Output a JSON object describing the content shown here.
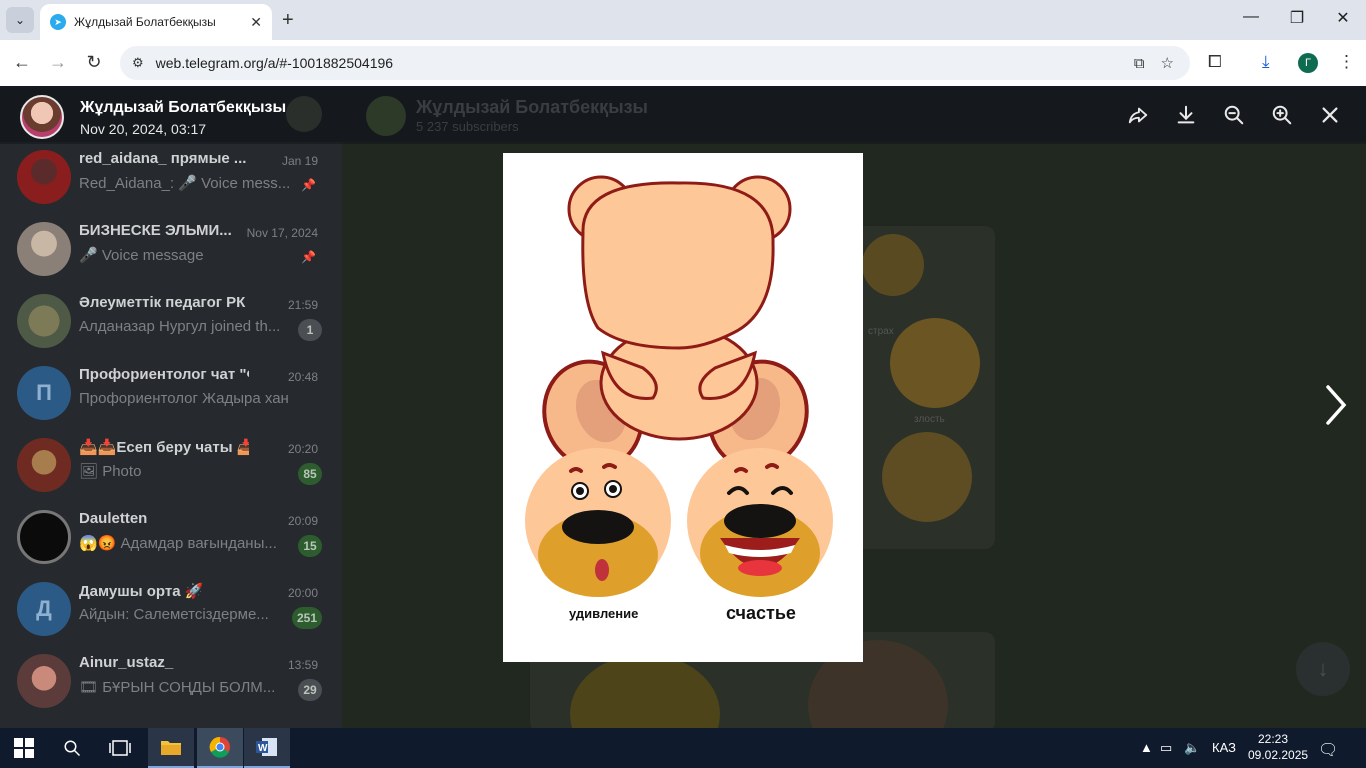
{
  "browser": {
    "tab_title": "Жұлдызай Болатбекқызы",
    "url": "web.telegram.org/a/#-1001882504196",
    "profile_initial": "Г"
  },
  "viewer": {
    "sender_name": "Жұлдызай Болатбекқызы",
    "date": "Nov 20, 2024, 03:17"
  },
  "chat_header": {
    "name": "Жұлдызай Болатбекқызы",
    "subtitle": "5 237 subscribers"
  },
  "chats": [
    {
      "name": "red_aidana_ прямые ...",
      "time": "Jan 19",
      "message": "Red_Aidana_: 🎤 Voice mess...",
      "badge": "",
      "pinned": true
    },
    {
      "name": "БИЗНЕСКЕ ЭЛЬМИ...",
      "time": "Nov 17, 2024",
      "message": "🎤 Voice message",
      "badge": "",
      "pinned": true
    },
    {
      "name": "Әлеуметтік педагог РК",
      "time": "21:59",
      "message": "Алданазар Нургул joined th...",
      "badge": "1",
      "muted": true
    },
    {
      "name": "Профориентолог чат \"Фо...",
      "time": "20:48",
      "message": "Профориентолог Жадыра хан...",
      "badge": ""
    },
    {
      "name": "📥📥Есеп беру чаты 📥",
      "time": "20:20",
      "message": "🖼 Photo",
      "badge": "85"
    },
    {
      "name": "Dauletten",
      "time": "20:09",
      "message": "😱😡 Адамдар вағынданы...",
      "badge": "15"
    },
    {
      "name": "Дамушы орта 🚀",
      "time": "20:00",
      "message": "Айдын: Салеметсіздерме...",
      "badge": "251"
    },
    {
      "name": "Ainur_ustaz_",
      "time": "13:59",
      "message": "🎞 БҰРЫН СОҢДЫ БОЛМ...",
      "badge": "29",
      "muted": true
    }
  ],
  "photo": {
    "label_left": "удивление",
    "label_right": "счастье"
  },
  "background_labels": {
    "fear": "страх",
    "anger": "злость"
  },
  "taskbar": {
    "language": "КАЗ",
    "time": "22:23",
    "date": "09.02.2025"
  }
}
